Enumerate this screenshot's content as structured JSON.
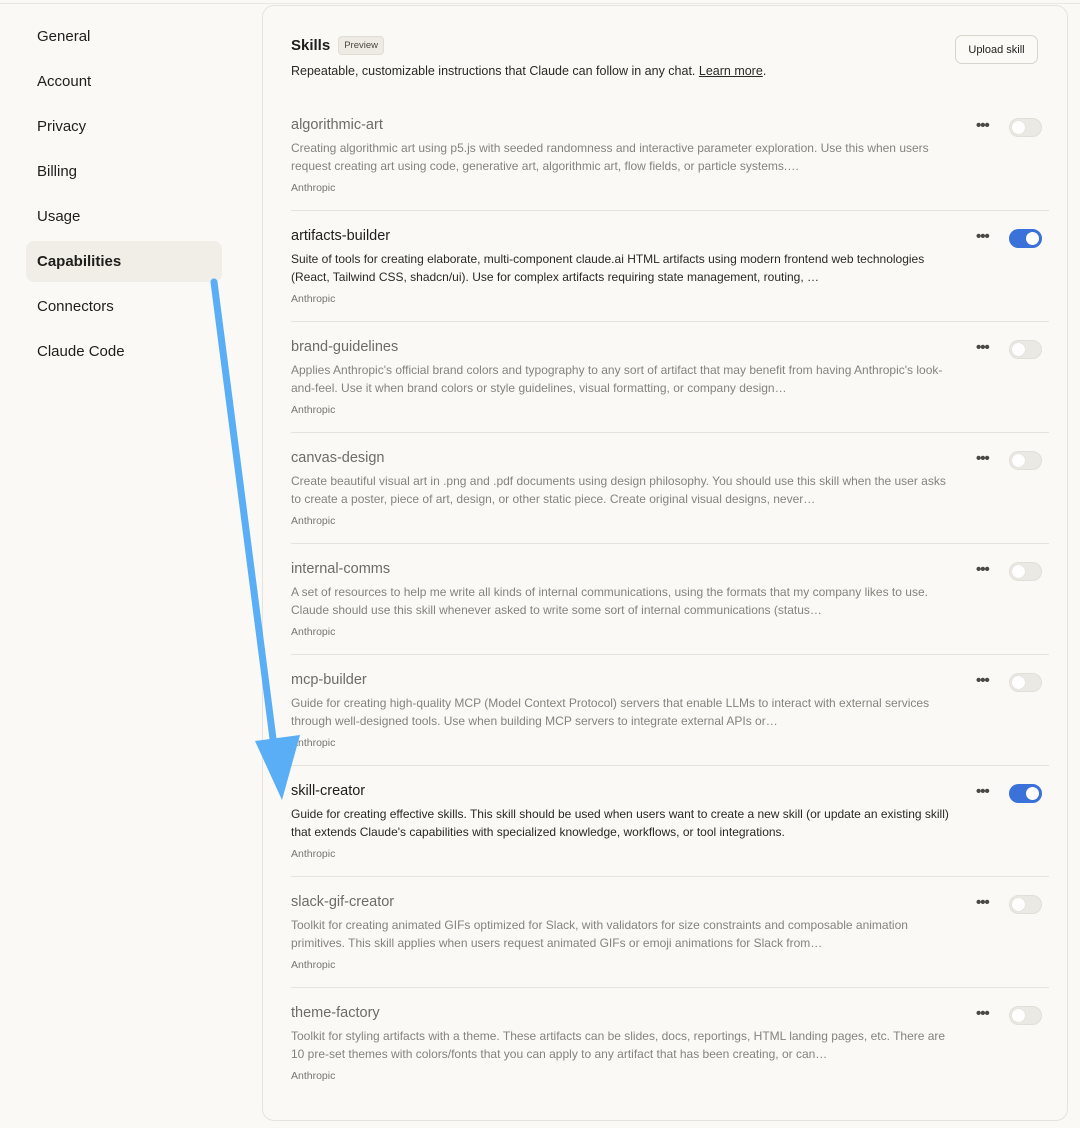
{
  "sidebar": {
    "items": [
      {
        "label": "General",
        "active": false
      },
      {
        "label": "Account",
        "active": false
      },
      {
        "label": "Privacy",
        "active": false
      },
      {
        "label": "Billing",
        "active": false
      },
      {
        "label": "Usage",
        "active": false
      },
      {
        "label": "Capabilities",
        "active": true
      },
      {
        "label": "Connectors",
        "active": false
      },
      {
        "label": "Claude Code",
        "active": false
      }
    ]
  },
  "skills_panel": {
    "title": "Skills",
    "badge": "Preview",
    "subtitle_text": "Repeatable, customizable instructions that Claude can follow in any chat. ",
    "learn_more": "Learn more",
    "subtitle_end": ".",
    "upload_label": "Upload skill",
    "more_label": "•••",
    "items": [
      {
        "name": "algorithmic-art",
        "description": "Creating algorithmic art using p5.js with seeded randomness and interactive parameter exploration. Use this when users request creating art using code, generative art, algorithmic art, flow fields, or particle systems.…",
        "author": "Anthropic",
        "enabled": false
      },
      {
        "name": "artifacts-builder",
        "description": "Suite of tools for creating elaborate, multi-component claude.ai HTML artifacts using modern frontend web technologies (React, Tailwind CSS, shadcn/ui). Use for complex artifacts requiring state management, routing, …",
        "author": "Anthropic",
        "enabled": true
      },
      {
        "name": "brand-guidelines",
        "description": "Applies Anthropic's official brand colors and typography to any sort of artifact that may benefit from having Anthropic's look-and-feel. Use it when brand colors or style guidelines, visual formatting, or company design…",
        "author": "Anthropic",
        "enabled": false
      },
      {
        "name": "canvas-design",
        "description": "Create beautiful visual art in .png and .pdf documents using design philosophy. You should use this skill when the user asks to create a poster, piece of art, design, or other static piece. Create original visual designs, never…",
        "author": "Anthropic",
        "enabled": false
      },
      {
        "name": "internal-comms",
        "description": "A set of resources to help me write all kinds of internal communications, using the formats that my company likes to use. Claude should use this skill whenever asked to write some sort of internal communications (status…",
        "author": "Anthropic",
        "enabled": false
      },
      {
        "name": "mcp-builder",
        "description": "Guide for creating high-quality MCP (Model Context Protocol) servers that enable LLMs to interact with external services through well-designed tools. Use when building MCP servers to integrate external APIs or…",
        "author": "Anthropic",
        "enabled": false
      },
      {
        "name": "skill-creator",
        "description": "Guide for creating effective skills. This skill should be used when users want to create a new skill (or update an existing skill) that extends Claude's capabilities with specialized knowledge, workflows, or tool integrations.",
        "author": "Anthropic",
        "enabled": true
      },
      {
        "name": "slack-gif-creator",
        "description": "Toolkit for creating animated GIFs optimized for Slack, with validators for size constraints and composable animation primitives. This skill applies when users request animated GIFs or emoji animations for Slack from…",
        "author": "Anthropic",
        "enabled": false
      },
      {
        "name": "theme-factory",
        "description": "Toolkit for styling artifacts with a theme. These artifacts can be slides, docs, reportings, HTML landing pages, etc. There are 10 pre-set themes with colors/fonts that you can apply to any artifact that has been creating, or can…",
        "author": "Anthropic",
        "enabled": false
      }
    ]
  },
  "colors": {
    "toggle_on": "#3b72d9",
    "annotation_arrow": "#5aaef5"
  }
}
